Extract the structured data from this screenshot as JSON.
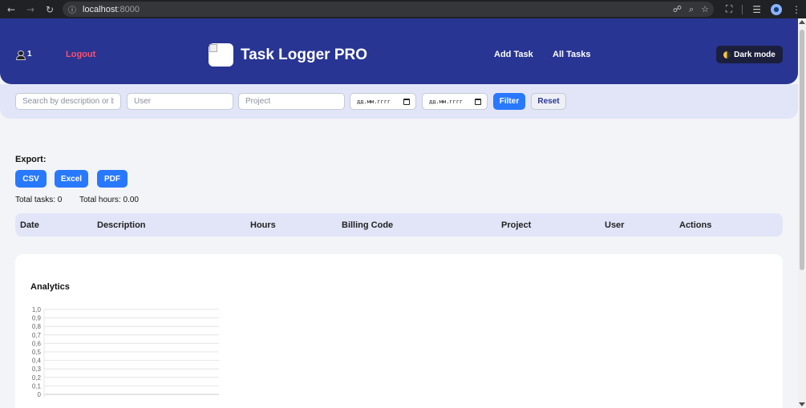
{
  "browser": {
    "url_host": "localhost",
    "url_port": ":8000"
  },
  "header": {
    "user_count": "1",
    "logout_label": "Logout",
    "title": "Task Logger PRO",
    "nav_add_task": "Add Task",
    "nav_all_tasks": "All Tasks",
    "dark_mode_label": "Dark mode"
  },
  "filters": {
    "search_placeholder": "Search by description or billing code",
    "user_placeholder": "User",
    "project_placeholder": "Project",
    "date_from_value": "дд.мм.гггг",
    "date_to_value": "дд.мм.гггг",
    "filter_label": "Filter",
    "reset_label": "Reset"
  },
  "export": {
    "label": "Export:",
    "csv": "CSV",
    "excel": "Excel",
    "pdf": "PDF"
  },
  "totals": {
    "tasks": "Total tasks: 0",
    "hours": "Total hours: 0.00"
  },
  "table": {
    "columns": [
      "Date",
      "Description",
      "Hours",
      "Billing Code",
      "Project",
      "User",
      "Actions"
    ]
  },
  "analytics": {
    "title": "Analytics"
  },
  "colors": {
    "header_bg": "#283593",
    "accent": "#2979ff",
    "logout": "#ff4f6a"
  },
  "chart_data": {
    "type": "bar",
    "categories": [],
    "values": [],
    "ylim": [
      0,
      1
    ],
    "yticks": [
      "1,0",
      "0,9",
      "0,8",
      "0,7",
      "0,6",
      "0,5",
      "0,4",
      "0,3",
      "0,2",
      "0,1",
      "0"
    ],
    "grid": true
  }
}
